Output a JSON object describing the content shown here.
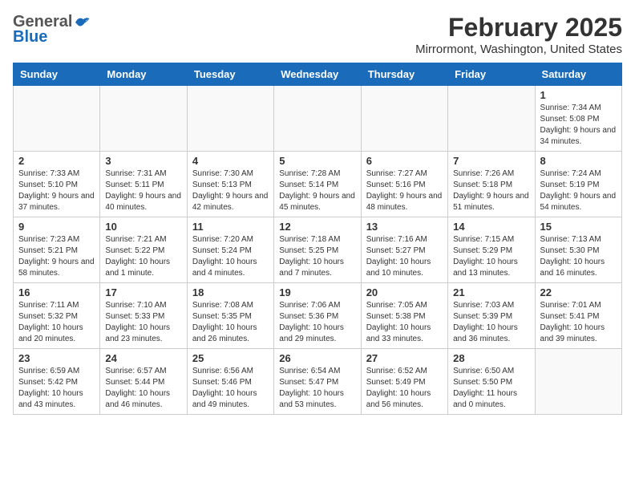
{
  "header": {
    "logo_general": "General",
    "logo_blue": "Blue",
    "title": "February 2025",
    "subtitle": "Mirrormont, Washington, United States"
  },
  "days_of_week": [
    "Sunday",
    "Monday",
    "Tuesday",
    "Wednesday",
    "Thursday",
    "Friday",
    "Saturday"
  ],
  "weeks": [
    [
      {
        "day": "",
        "info": ""
      },
      {
        "day": "",
        "info": ""
      },
      {
        "day": "",
        "info": ""
      },
      {
        "day": "",
        "info": ""
      },
      {
        "day": "",
        "info": ""
      },
      {
        "day": "",
        "info": ""
      },
      {
        "day": "1",
        "info": "Sunrise: 7:34 AM\nSunset: 5:08 PM\nDaylight: 9 hours and 34 minutes."
      }
    ],
    [
      {
        "day": "2",
        "info": "Sunrise: 7:33 AM\nSunset: 5:10 PM\nDaylight: 9 hours and 37 minutes."
      },
      {
        "day": "3",
        "info": "Sunrise: 7:31 AM\nSunset: 5:11 PM\nDaylight: 9 hours and 40 minutes."
      },
      {
        "day": "4",
        "info": "Sunrise: 7:30 AM\nSunset: 5:13 PM\nDaylight: 9 hours and 42 minutes."
      },
      {
        "day": "5",
        "info": "Sunrise: 7:28 AM\nSunset: 5:14 PM\nDaylight: 9 hours and 45 minutes."
      },
      {
        "day": "6",
        "info": "Sunrise: 7:27 AM\nSunset: 5:16 PM\nDaylight: 9 hours and 48 minutes."
      },
      {
        "day": "7",
        "info": "Sunrise: 7:26 AM\nSunset: 5:18 PM\nDaylight: 9 hours and 51 minutes."
      },
      {
        "day": "8",
        "info": "Sunrise: 7:24 AM\nSunset: 5:19 PM\nDaylight: 9 hours and 54 minutes."
      }
    ],
    [
      {
        "day": "9",
        "info": "Sunrise: 7:23 AM\nSunset: 5:21 PM\nDaylight: 9 hours and 58 minutes."
      },
      {
        "day": "10",
        "info": "Sunrise: 7:21 AM\nSunset: 5:22 PM\nDaylight: 10 hours and 1 minute."
      },
      {
        "day": "11",
        "info": "Sunrise: 7:20 AM\nSunset: 5:24 PM\nDaylight: 10 hours and 4 minutes."
      },
      {
        "day": "12",
        "info": "Sunrise: 7:18 AM\nSunset: 5:25 PM\nDaylight: 10 hours and 7 minutes."
      },
      {
        "day": "13",
        "info": "Sunrise: 7:16 AM\nSunset: 5:27 PM\nDaylight: 10 hours and 10 minutes."
      },
      {
        "day": "14",
        "info": "Sunrise: 7:15 AM\nSunset: 5:29 PM\nDaylight: 10 hours and 13 minutes."
      },
      {
        "day": "15",
        "info": "Sunrise: 7:13 AM\nSunset: 5:30 PM\nDaylight: 10 hours and 16 minutes."
      }
    ],
    [
      {
        "day": "16",
        "info": "Sunrise: 7:11 AM\nSunset: 5:32 PM\nDaylight: 10 hours and 20 minutes."
      },
      {
        "day": "17",
        "info": "Sunrise: 7:10 AM\nSunset: 5:33 PM\nDaylight: 10 hours and 23 minutes."
      },
      {
        "day": "18",
        "info": "Sunrise: 7:08 AM\nSunset: 5:35 PM\nDaylight: 10 hours and 26 minutes."
      },
      {
        "day": "19",
        "info": "Sunrise: 7:06 AM\nSunset: 5:36 PM\nDaylight: 10 hours and 29 minutes."
      },
      {
        "day": "20",
        "info": "Sunrise: 7:05 AM\nSunset: 5:38 PM\nDaylight: 10 hours and 33 minutes."
      },
      {
        "day": "21",
        "info": "Sunrise: 7:03 AM\nSunset: 5:39 PM\nDaylight: 10 hours and 36 minutes."
      },
      {
        "day": "22",
        "info": "Sunrise: 7:01 AM\nSunset: 5:41 PM\nDaylight: 10 hours and 39 minutes."
      }
    ],
    [
      {
        "day": "23",
        "info": "Sunrise: 6:59 AM\nSunset: 5:42 PM\nDaylight: 10 hours and 43 minutes."
      },
      {
        "day": "24",
        "info": "Sunrise: 6:57 AM\nSunset: 5:44 PM\nDaylight: 10 hours and 46 minutes."
      },
      {
        "day": "25",
        "info": "Sunrise: 6:56 AM\nSunset: 5:46 PM\nDaylight: 10 hours and 49 minutes."
      },
      {
        "day": "26",
        "info": "Sunrise: 6:54 AM\nSunset: 5:47 PM\nDaylight: 10 hours and 53 minutes."
      },
      {
        "day": "27",
        "info": "Sunrise: 6:52 AM\nSunset: 5:49 PM\nDaylight: 10 hours and 56 minutes."
      },
      {
        "day": "28",
        "info": "Sunrise: 6:50 AM\nSunset: 5:50 PM\nDaylight: 11 hours and 0 minutes."
      },
      {
        "day": "",
        "info": ""
      }
    ]
  ]
}
